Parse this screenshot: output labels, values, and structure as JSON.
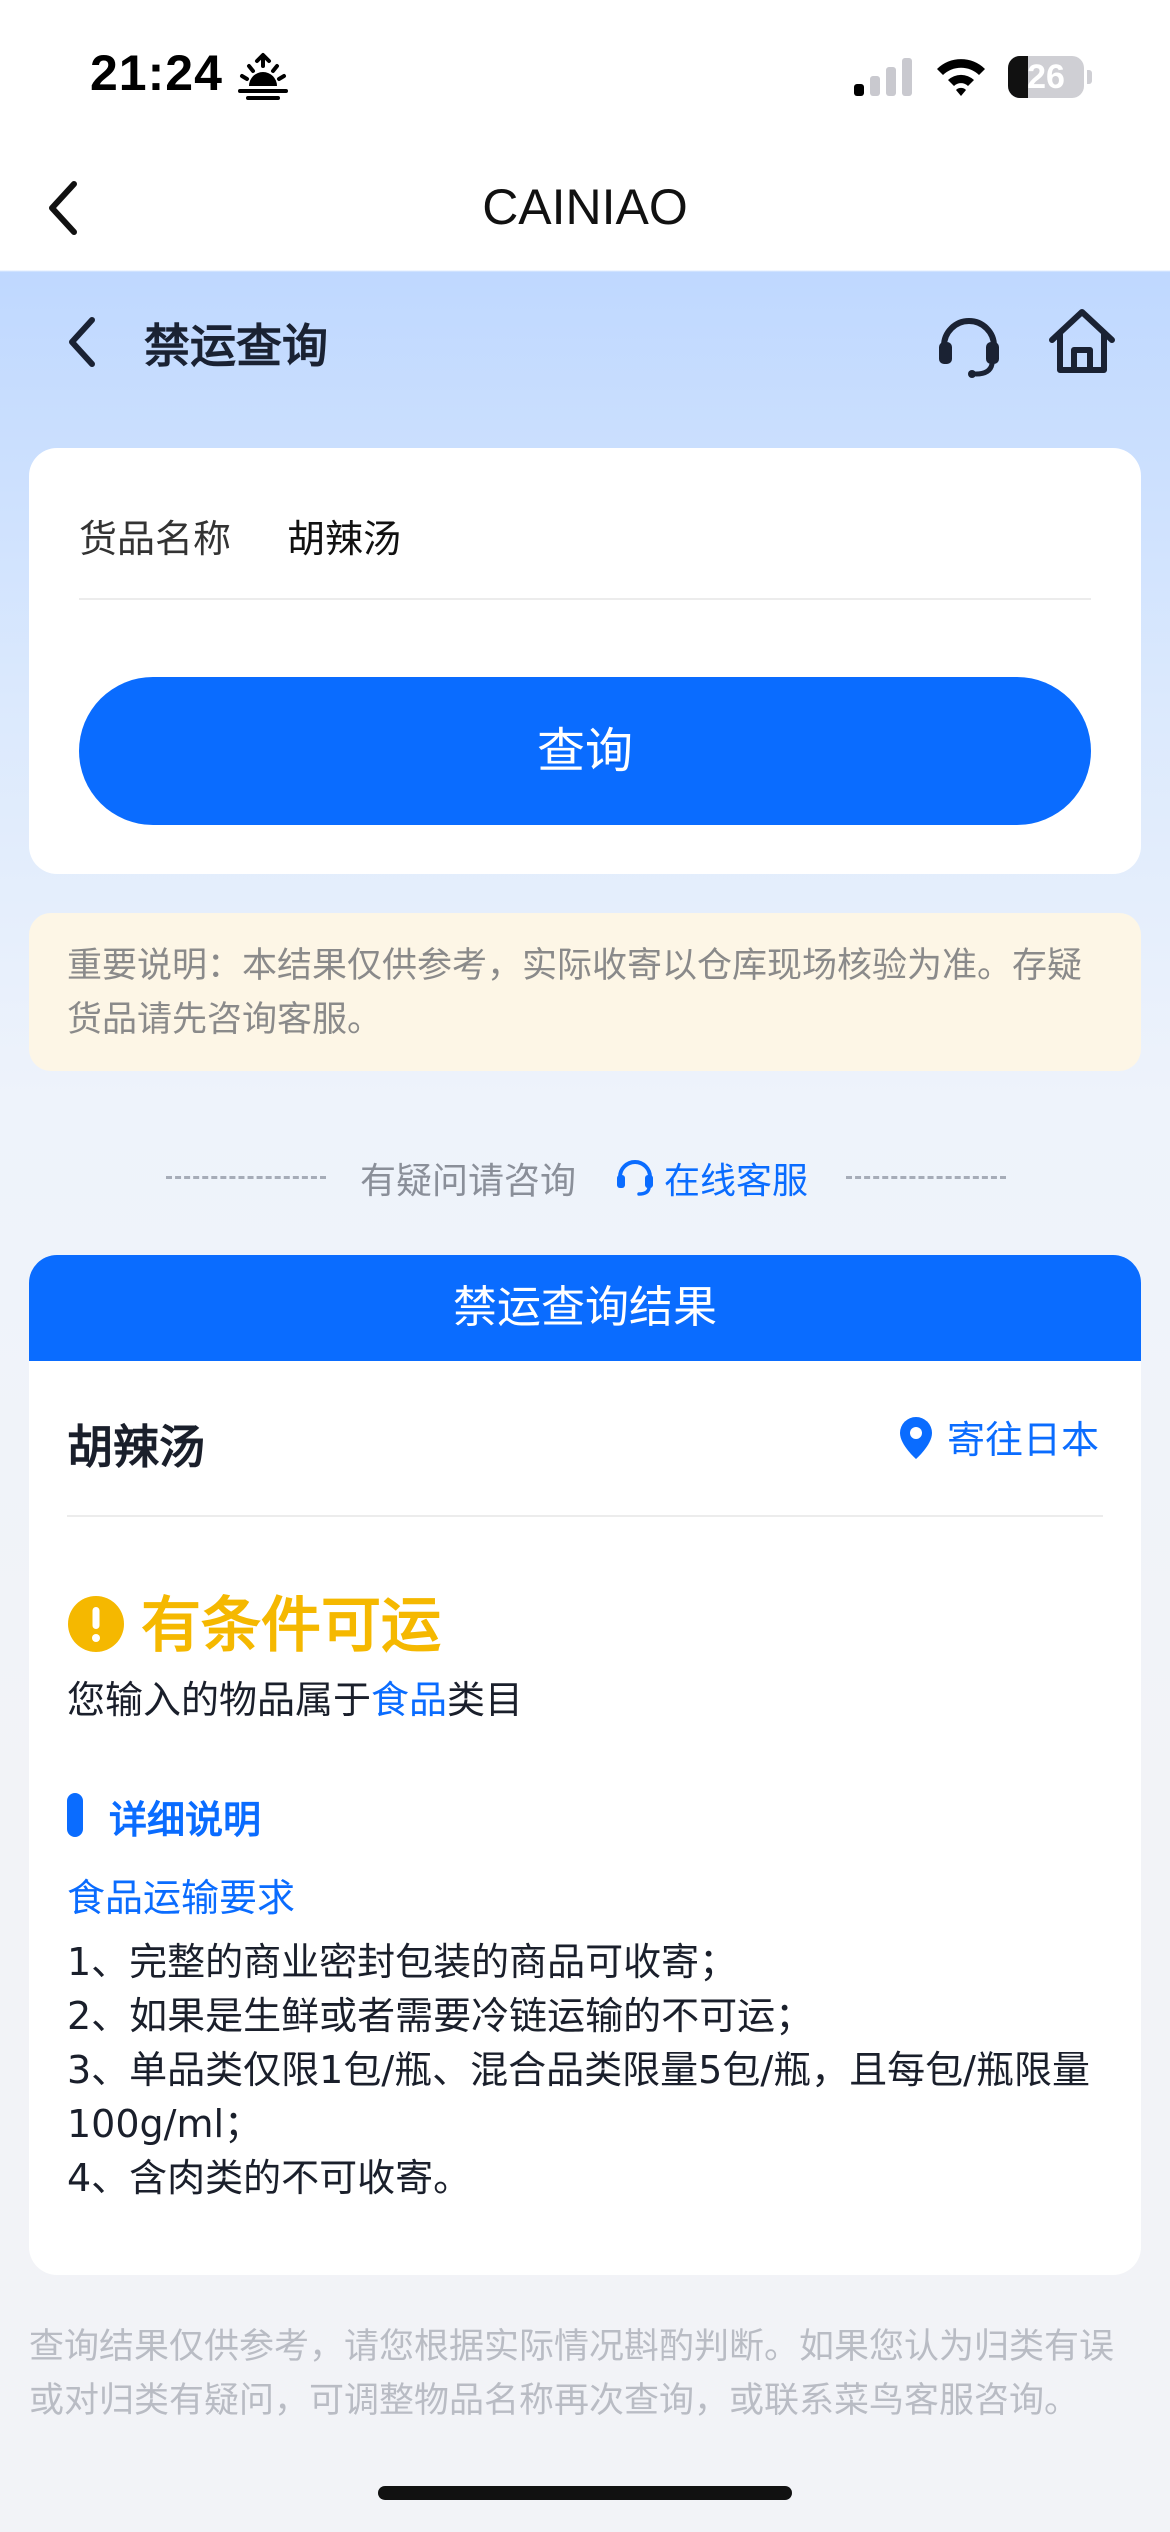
{
  "status_bar": {
    "time": "21:24",
    "battery_level": "26",
    "battery_fraction": 0.26,
    "icons": [
      "sunset-icon",
      "signal-icon",
      "wifi-icon",
      "battery-icon"
    ]
  },
  "nav": {
    "title": "CAINIAO",
    "back_icon": "chevron-left-icon"
  },
  "page": {
    "title": "禁运查询",
    "icons": [
      "headset-icon",
      "home-icon"
    ]
  },
  "query": {
    "field_label": "货品名称",
    "field_value": "胡辣汤",
    "button_label": "查询"
  },
  "notice": {
    "text": "重要说明：本结果仅供参考，实际收寄以仓库现场核验为准。存疑货品请先咨询客服。"
  },
  "consult": {
    "text": "有疑问请咨询",
    "link": "在线客服"
  },
  "result": {
    "header": "禁运查询结果",
    "item_name": "胡辣汤",
    "destination": "寄往日本",
    "status": "有条件可运",
    "category_prefix": "您输入的物品属于",
    "category": "食品",
    "category_suffix": "类目",
    "section_title": "详细说明",
    "requirements_title": "食品运输要求",
    "requirements": [
      "1、完整的商业密封包装的商品可收寄；",
      "2、如果是生鲜或者需要冷链运输的不可运；",
      "3、单品类仅限1包/瓶、混合品类限量5包/瓶，且每包/瓶限量100g/ml；",
      "4、含肉类的不可收寄。"
    ]
  },
  "footer": {
    "note": "查询结果仅供参考，请您根据实际情况斟酌判断。如果您认为归类有误或对归类有疑问，可调整物品名称再次查询，或联系菜鸟客服咨询。"
  },
  "colors": {
    "accent": "#0a6cff",
    "warning": "#f5b800",
    "notice_bg": "#fdf6e6"
  }
}
